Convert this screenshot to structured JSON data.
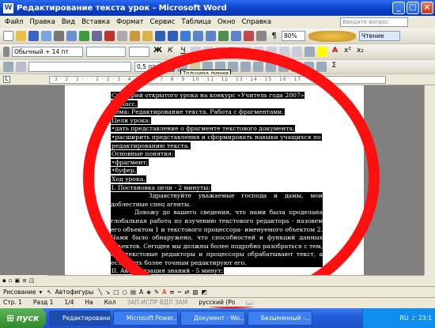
{
  "window": {
    "title": "Редактирование текста урок - Microsoft Word"
  },
  "menu": [
    "Файл",
    "Правка",
    "Вид",
    "Вставка",
    "Формат",
    "Сервис",
    "Таблица",
    "Окно",
    "Справка"
  ],
  "help_placeholder": "Введите вопрос",
  "toolbar": {
    "zoom": "80%",
    "read_label": "Чтение",
    "style": "Обычный + 14 пт",
    "line_width": "0,5 пт",
    "tooltip": "Толщина линии"
  },
  "document": {
    "lines": [
      "Сценарий открытого урока на конкурс «Учитель года 2007»",
      "6 класс.",
      "Тема: Редактирование текста. Работа с фрагментами.",
      "Цели урока:",
      "•дать представление о фрагменте текстового документа;",
      "•расширить представления и сформировать навыки учащихся по",
      "  редактированию текста.",
      "Основные понятия:",
      "•фрагмент;",
      "•буфер.",
      "Ход урока.",
      "I.      Постановка цели - 2 минуты;"
    ],
    "para1": "Здравствуйте уважаемые господа и дамы, мои доблестные спец агенты.",
    "para2": "Довожу до вашего сведения, что нами была проделана глобальная работа по изучению текстового редактора - назовем его объектом 1 и текстового процессора- именуемого объектом 2. Нами было обнаружено, что способностей и функций данных объектов. Сегодня мы должны более подробно разобраться с тем, как текстовые редакторы и процессоры обрабатывают текст, а если быть более точным редактируют его.",
    "last": "II.     Актуализация знаний - 5 минут;"
  },
  "drawing_toolbar": {
    "draw": "Рисование",
    "autoshapes": "Автофигуры"
  },
  "status": {
    "page": "Стр. 1",
    "section": "Разд 1",
    "pages": "1/4",
    "at": "На",
    "col": "Кол",
    "flags": "ЗАП ИСПР ВДЛ ЗАМ",
    "lang": "русский (Ро"
  },
  "taskbar": {
    "start": "пуск",
    "tasks": [
      "Редактировани...",
      "Microsoft Power...",
      "Документ - Wo...",
      "Безымянный -..."
    ],
    "lang": "RU",
    "time": "23:1"
  }
}
